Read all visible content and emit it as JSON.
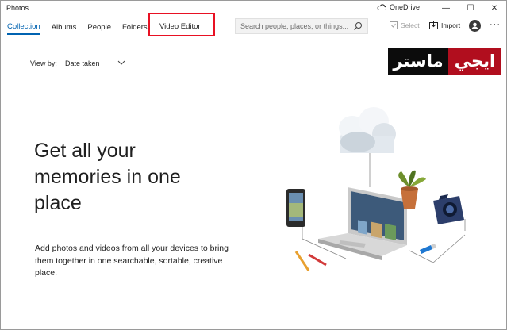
{
  "window": {
    "title": "Photos",
    "onedrive_label": "OneDrive",
    "minimize_glyph": "—",
    "maximize_glyph": "☐",
    "close_glyph": "✕"
  },
  "nav": {
    "tabs": [
      {
        "label": "Collection",
        "active": true
      },
      {
        "label": "Albums"
      },
      {
        "label": "People"
      },
      {
        "label": "Folders"
      }
    ],
    "video_editor_label": "Video Editor",
    "highlight_color": "#e81123"
  },
  "search": {
    "placeholder": "Search people, places, or things..."
  },
  "toolbar": {
    "select_label": "Select",
    "import_label": "Import",
    "more_glyph": "···"
  },
  "view_by": {
    "label": "View by:",
    "value": "Date taken"
  },
  "watermark": {
    "black_part": "ماستر",
    "red_part": "ايجي"
  },
  "hero": {
    "headline": "Get all your memories in one place",
    "description": "Add photos and videos from all your devices to bring them together in one searchable, sortable, creative place."
  },
  "colors": {
    "accent": "#0063b1",
    "watermark_red": "#b10e1e",
    "watermark_black": "#0c0c0c"
  },
  "icons": [
    "cloud-icon",
    "search-icon",
    "select-icon",
    "import-icon",
    "avatar-icon",
    "chevron-down-icon"
  ]
}
